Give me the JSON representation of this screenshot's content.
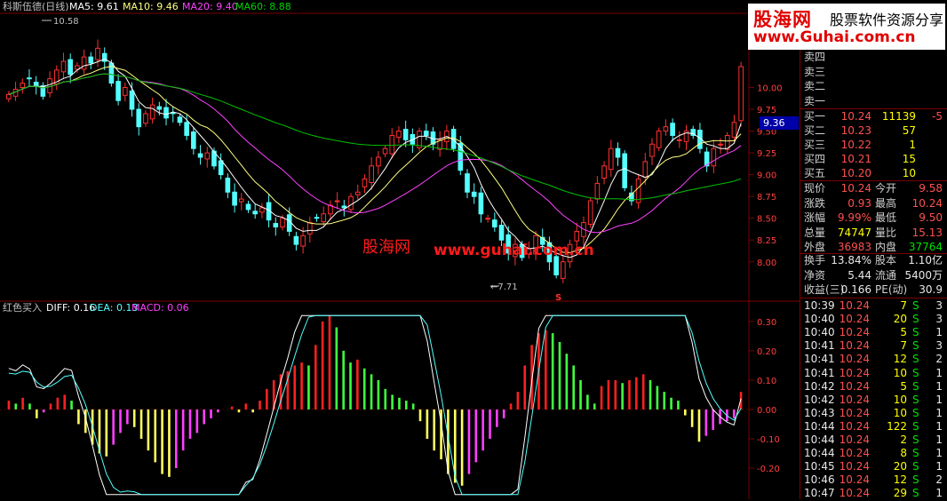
{
  "header": {
    "stock_title": "科斯伍德(日线)",
    "ma5_label": "MA5: 9.61",
    "ma10_label": "MA10: 9.46",
    "ma20_label": "MA20: 9.40",
    "ma60_label": "MA60: 8.88",
    "indicator_title": "红色买入",
    "diff_label": "DIFF: 0.16",
    "dea_label": "DEA: 0.13",
    "macd_label": "MACD: 0.06",
    "peak_label": "10.58",
    "trough_label": "←7.71",
    "s_marker": "S",
    "current_price_tag": "9.36",
    "colors": {
      "ma5": "#ffffff",
      "ma10": "#ffff80",
      "ma20": "#ff40ff",
      "ma60": "#00c000",
      "up": "#ff3030",
      "down": "#54ffff",
      "diff": "#ffffff",
      "dea": "#54ffff"
    }
  },
  "watermark": {
    "logo": "股海网",
    "tagline": "股票软件资源分享",
    "url": "www.Guhai.com.cn",
    "mid_logo": "股海网",
    "mid_url": "www.guhai.com.cn"
  },
  "chart_data": [
    {
      "type": "candlestick",
      "title": "科斯伍德(日线)",
      "ylim": [
        7.6,
        10.8
      ],
      "y_ticks": [
        "10.00",
        "9.75",
        "9.50",
        "9.25",
        "9.00",
        "8.75",
        "8.50",
        "8.25",
        "8.00"
      ],
      "y_tick_values": [
        10.0,
        9.75,
        9.5,
        9.25,
        9.0,
        8.75,
        8.5,
        8.25,
        8.0
      ],
      "close": [
        9.92,
        9.98,
        10.05,
        10.1,
        10.02,
        9.9,
        10.1,
        10.2,
        10.3,
        10.15,
        10.25,
        10.35,
        10.28,
        10.45,
        10.3,
        10.05,
        9.85,
        10.0,
        9.75,
        9.55,
        9.7,
        9.8,
        9.75,
        9.65,
        9.7,
        9.6,
        9.45,
        9.3,
        9.2,
        9.25,
        9.1,
        9.0,
        8.8,
        8.65,
        8.72,
        8.6,
        8.55,
        8.62,
        8.48,
        8.4,
        8.5,
        8.35,
        8.2,
        8.3,
        8.45,
        8.5,
        8.55,
        8.65,
        8.7,
        8.62,
        8.75,
        8.8,
        8.95,
        9.1,
        9.2,
        9.3,
        9.45,
        9.5,
        9.4,
        9.35,
        9.5,
        9.45,
        9.35,
        9.4,
        9.5,
        9.3,
        9.05,
        8.8,
        8.75,
        8.55,
        8.5,
        8.4,
        8.25,
        8.1,
        8.2,
        8.05,
        8.15,
        8.3,
        8.2,
        8.0,
        7.85,
        8.0,
        8.2,
        8.35,
        8.45,
        8.7,
        8.9,
        9.1,
        9.3,
        9.2,
        8.85,
        8.7,
        8.95,
        9.15,
        9.35,
        9.5,
        9.55,
        9.45,
        9.4,
        9.5,
        9.45,
        9.3,
        9.1,
        9.3,
        9.35,
        9.45,
        9.6,
        10.24
      ],
      "ma_lines": [
        {
          "name": "MA5",
          "value": 9.61
        },
        {
          "name": "MA10",
          "value": 9.46
        },
        {
          "name": "MA20",
          "value": 9.4
        },
        {
          "name": "MA60",
          "value": 8.88
        }
      ],
      "annotations": [
        {
          "text": "10.58",
          "value": 10.58
        },
        {
          "text": "←7.71",
          "value": 7.71
        }
      ]
    },
    {
      "type": "macd",
      "title": "红色买入",
      "ylim": [
        -0.3,
        0.33
      ],
      "y_ticks": [
        "0.30",
        "0.20",
        "0.10",
        "0.00",
        "-0.10",
        "-0.20"
      ],
      "y_tick_values": [
        0.3,
        0.2,
        0.1,
        0.0,
        -0.1,
        -0.2
      ],
      "series": [
        {
          "name": "DIFF",
          "last": 0.16
        },
        {
          "name": "DEA",
          "last": 0.13
        },
        {
          "name": "MACD",
          "last": 0.06
        }
      ],
      "macd": [
        0.03,
        0.02,
        0.04,
        0.02,
        -0.03,
        -0.01,
        0.02,
        0.04,
        0.05,
        0.03,
        -0.05,
        -0.08,
        -0.12,
        -0.15,
        -0.16,
        -0.12,
        -0.08,
        -0.05,
        -0.06,
        -0.1,
        -0.14,
        -0.18,
        -0.22,
        -0.23,
        -0.2,
        -0.14,
        -0.1,
        -0.08,
        -0.05,
        -0.03,
        -0.01,
        0.0,
        0.01,
        -0.01,
        0.02,
        -0.01,
        0.03,
        0.07,
        0.1,
        0.12,
        0.13,
        0.15,
        0.16,
        0.15,
        0.22,
        0.3,
        0.32,
        0.28,
        0.2,
        0.16,
        0.17,
        0.14,
        0.12,
        0.1,
        0.07,
        0.05,
        0.04,
        0.03,
        0.02,
        -0.04,
        -0.1,
        -0.14,
        -0.17,
        -0.22,
        -0.25,
        -0.26,
        -0.22,
        -0.18,
        -0.14,
        -0.1,
        -0.06,
        -0.03,
        0.02,
        0.06,
        0.15,
        0.22,
        0.26,
        0.27,
        0.26,
        0.23,
        0.19,
        0.15,
        0.1,
        0.05,
        0.02,
        0.08,
        0.1,
        0.1,
        0.09,
        0.1,
        0.11,
        0.12,
        0.1,
        0.08,
        0.06,
        0.04,
        0.03,
        -0.02,
        -0.06,
        -0.11,
        -0.09,
        -0.07,
        -0.05,
        -0.04,
        -0.03,
        0.06
      ]
    }
  ],
  "quote": {
    "sell_labels": [
      "卖四",
      "卖三",
      "卖二",
      "卖一"
    ],
    "buys": [
      {
        "label": "买一",
        "price": "10.24",
        "vol": "11139",
        "extra": "-5"
      },
      {
        "label": "买二",
        "price": "10.23",
        "vol": "57",
        "extra": ""
      },
      {
        "label": "买三",
        "price": "10.22",
        "vol": "1",
        "extra": ""
      },
      {
        "label": "买四",
        "price": "10.21",
        "vol": "15",
        "extra": ""
      },
      {
        "label": "买五",
        "price": "10.20",
        "vol": "10",
        "extra": ""
      }
    ],
    "stats": [
      {
        "l1": "现价",
        "v1": "10.24",
        "l2": "今开",
        "v2": "9.58"
      },
      {
        "l1": "涨跌",
        "v1": "0.93",
        "l2": "最高",
        "v2": "10.24"
      },
      {
        "l1": "涨幅",
        "v1": "9.99%",
        "l2": "最低",
        "v2": "9.50"
      },
      {
        "l1": "总量",
        "v1": "74747",
        "l2": "量比",
        "v2": "15.13"
      },
      {
        "l1": "外盘",
        "v1": "36983",
        "l2": "内盘",
        "v2": "37764"
      }
    ],
    "finance": [
      {
        "l1": "换手",
        "v1": "13.84%",
        "l2": "股本",
        "v2": "1.10亿"
      },
      {
        "l1": "净资",
        "v1": "5.44",
        "l2": "流通",
        "v2": "5400万"
      },
      {
        "l1": "收益(三)",
        "v1": "0.166",
        "l2": "PE(动)",
        "v2": "30.9"
      }
    ],
    "ticks": [
      {
        "time": "10:39",
        "price": "10.24",
        "vol": "7",
        "side": "S",
        "n": "3"
      },
      {
        "time": "10:40",
        "price": "10.24",
        "vol": "20",
        "side": "S",
        "n": "3"
      },
      {
        "time": "10:40",
        "price": "10.24",
        "vol": "5",
        "side": "S",
        "n": "1"
      },
      {
        "time": "10:41",
        "price": "10.24",
        "vol": "7",
        "side": "S",
        "n": "3"
      },
      {
        "time": "10:41",
        "price": "10.24",
        "vol": "12",
        "side": "S",
        "n": "2"
      },
      {
        "time": "10:41",
        "price": "10.24",
        "vol": "10",
        "side": "S",
        "n": "1"
      },
      {
        "time": "10:42",
        "price": "10.24",
        "vol": "5",
        "side": "S",
        "n": "1"
      },
      {
        "time": "10:42",
        "price": "10.24",
        "vol": "10",
        "side": "S",
        "n": "1"
      },
      {
        "time": "10:43",
        "price": "10.24",
        "vol": "10",
        "side": "S",
        "n": "1"
      },
      {
        "time": "10:44",
        "price": "10.24",
        "vol": "122",
        "side": "S",
        "n": "1"
      },
      {
        "time": "10:44",
        "price": "10.24",
        "vol": "2",
        "side": "S",
        "n": "1"
      },
      {
        "time": "10:44",
        "price": "10.24",
        "vol": "8",
        "side": "S",
        "n": "1"
      },
      {
        "time": "10:45",
        "price": "10.24",
        "vol": "20",
        "side": "S",
        "n": "1"
      },
      {
        "time": "10:46",
        "price": "10.24",
        "vol": "12",
        "side": "S",
        "n": "2"
      },
      {
        "time": "10:47",
        "price": "10.24",
        "vol": "29",
        "side": "S",
        "n": "1"
      }
    ]
  }
}
